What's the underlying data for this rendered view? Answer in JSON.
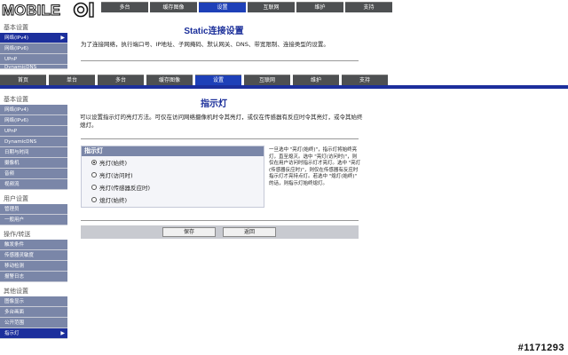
{
  "logo": "MOBILE01",
  "upper": {
    "tabs": [
      {
        "label": "多台",
        "active": false
      },
      {
        "label": "缓存图像",
        "active": false
      },
      {
        "label": "设置",
        "active": true
      },
      {
        "label": "互联网",
        "active": false
      },
      {
        "label": "维护",
        "active": false
      },
      {
        "label": "支持",
        "active": false
      }
    ],
    "sidebar": {
      "heading": "基本设置",
      "items": [
        {
          "label": "网络(IPv4)",
          "active": true
        },
        {
          "label": "网络(IPv6)",
          "active": false
        },
        {
          "label": "UPnP",
          "active": false
        },
        {
          "label": "DynamicDNS",
          "active": false
        }
      ]
    },
    "title": "Static连接设置",
    "description": "为了连接网络，执行端口号、IP地址、子网掩码、默认网关、DNS、带宽限制、连接类型的设置。"
  },
  "lower": {
    "tabs": [
      {
        "label": "首页",
        "active": false
      },
      {
        "label": "单台",
        "active": false
      },
      {
        "label": "多台",
        "active": false
      },
      {
        "label": "缓存图像",
        "active": false
      },
      {
        "label": "设置",
        "active": true
      },
      {
        "label": "互联网",
        "active": false
      },
      {
        "label": "维护",
        "active": false
      },
      {
        "label": "支持",
        "active": false
      }
    ],
    "sidebar": [
      {
        "heading": "基本设置",
        "items": [
          {
            "label": "网络(IPv4)",
            "active": false
          },
          {
            "label": "网络(IPv6)",
            "active": false
          },
          {
            "label": "UPnP",
            "active": false
          },
          {
            "label": "DynamicDNS",
            "active": false
          },
          {
            "label": "日期与时间",
            "active": false
          },
          {
            "label": "摄像机",
            "active": false
          },
          {
            "label": "音频",
            "active": false
          },
          {
            "label": "视频流",
            "active": false
          }
        ]
      },
      {
        "heading": "用户设置",
        "items": [
          {
            "label": "管理员",
            "active": false
          },
          {
            "label": "一般用户",
            "active": false
          }
        ]
      },
      {
        "heading": "操作/转送",
        "items": [
          {
            "label": "触发条件",
            "active": false
          },
          {
            "label": "传感器灵敏度",
            "active": false
          },
          {
            "label": "移动检测",
            "active": false
          },
          {
            "label": "报警日志",
            "active": false
          }
        ]
      },
      {
        "heading": "其他设置",
        "items": [
          {
            "label": "图像显示",
            "active": false
          },
          {
            "label": "多台画面",
            "active": false
          },
          {
            "label": "公开范围",
            "active": false
          },
          {
            "label": "指示灯",
            "active": true
          }
        ]
      }
    ],
    "title": "指示灯",
    "description": "可以设置指示灯的亮灯方法。可仅在访问网络摄像机时令其亮灯，或仅在传感器有反应时令其亮灯，或令其始终熄灯。",
    "panel": {
      "heading": "指示灯",
      "options": [
        {
          "label": "亮灯(始终)",
          "selected": true
        },
        {
          "label": "亮灯(访问时)",
          "selected": false
        },
        {
          "label": "亮灯(传感器反应时)",
          "selected": false
        },
        {
          "label": "熄灯(始终)",
          "selected": false
        }
      ]
    },
    "help": "一旦选中 \"亮灯(始终)\"，指示灯将始终亮灯，直至熄灭。选中 \"亮灯(访问时)\"，则仅在用户访问时指示灯才亮灯。选中 \"亮灯(传感器反应时)\"，则仅在传感器有反应时指示灯才亮持点灯。若选中 \"熄灯(始终)\" 的话，则指示灯始终熄灯。",
    "buttons": {
      "save": "保存",
      "back": "返回"
    }
  },
  "watermark": "#1171293"
}
